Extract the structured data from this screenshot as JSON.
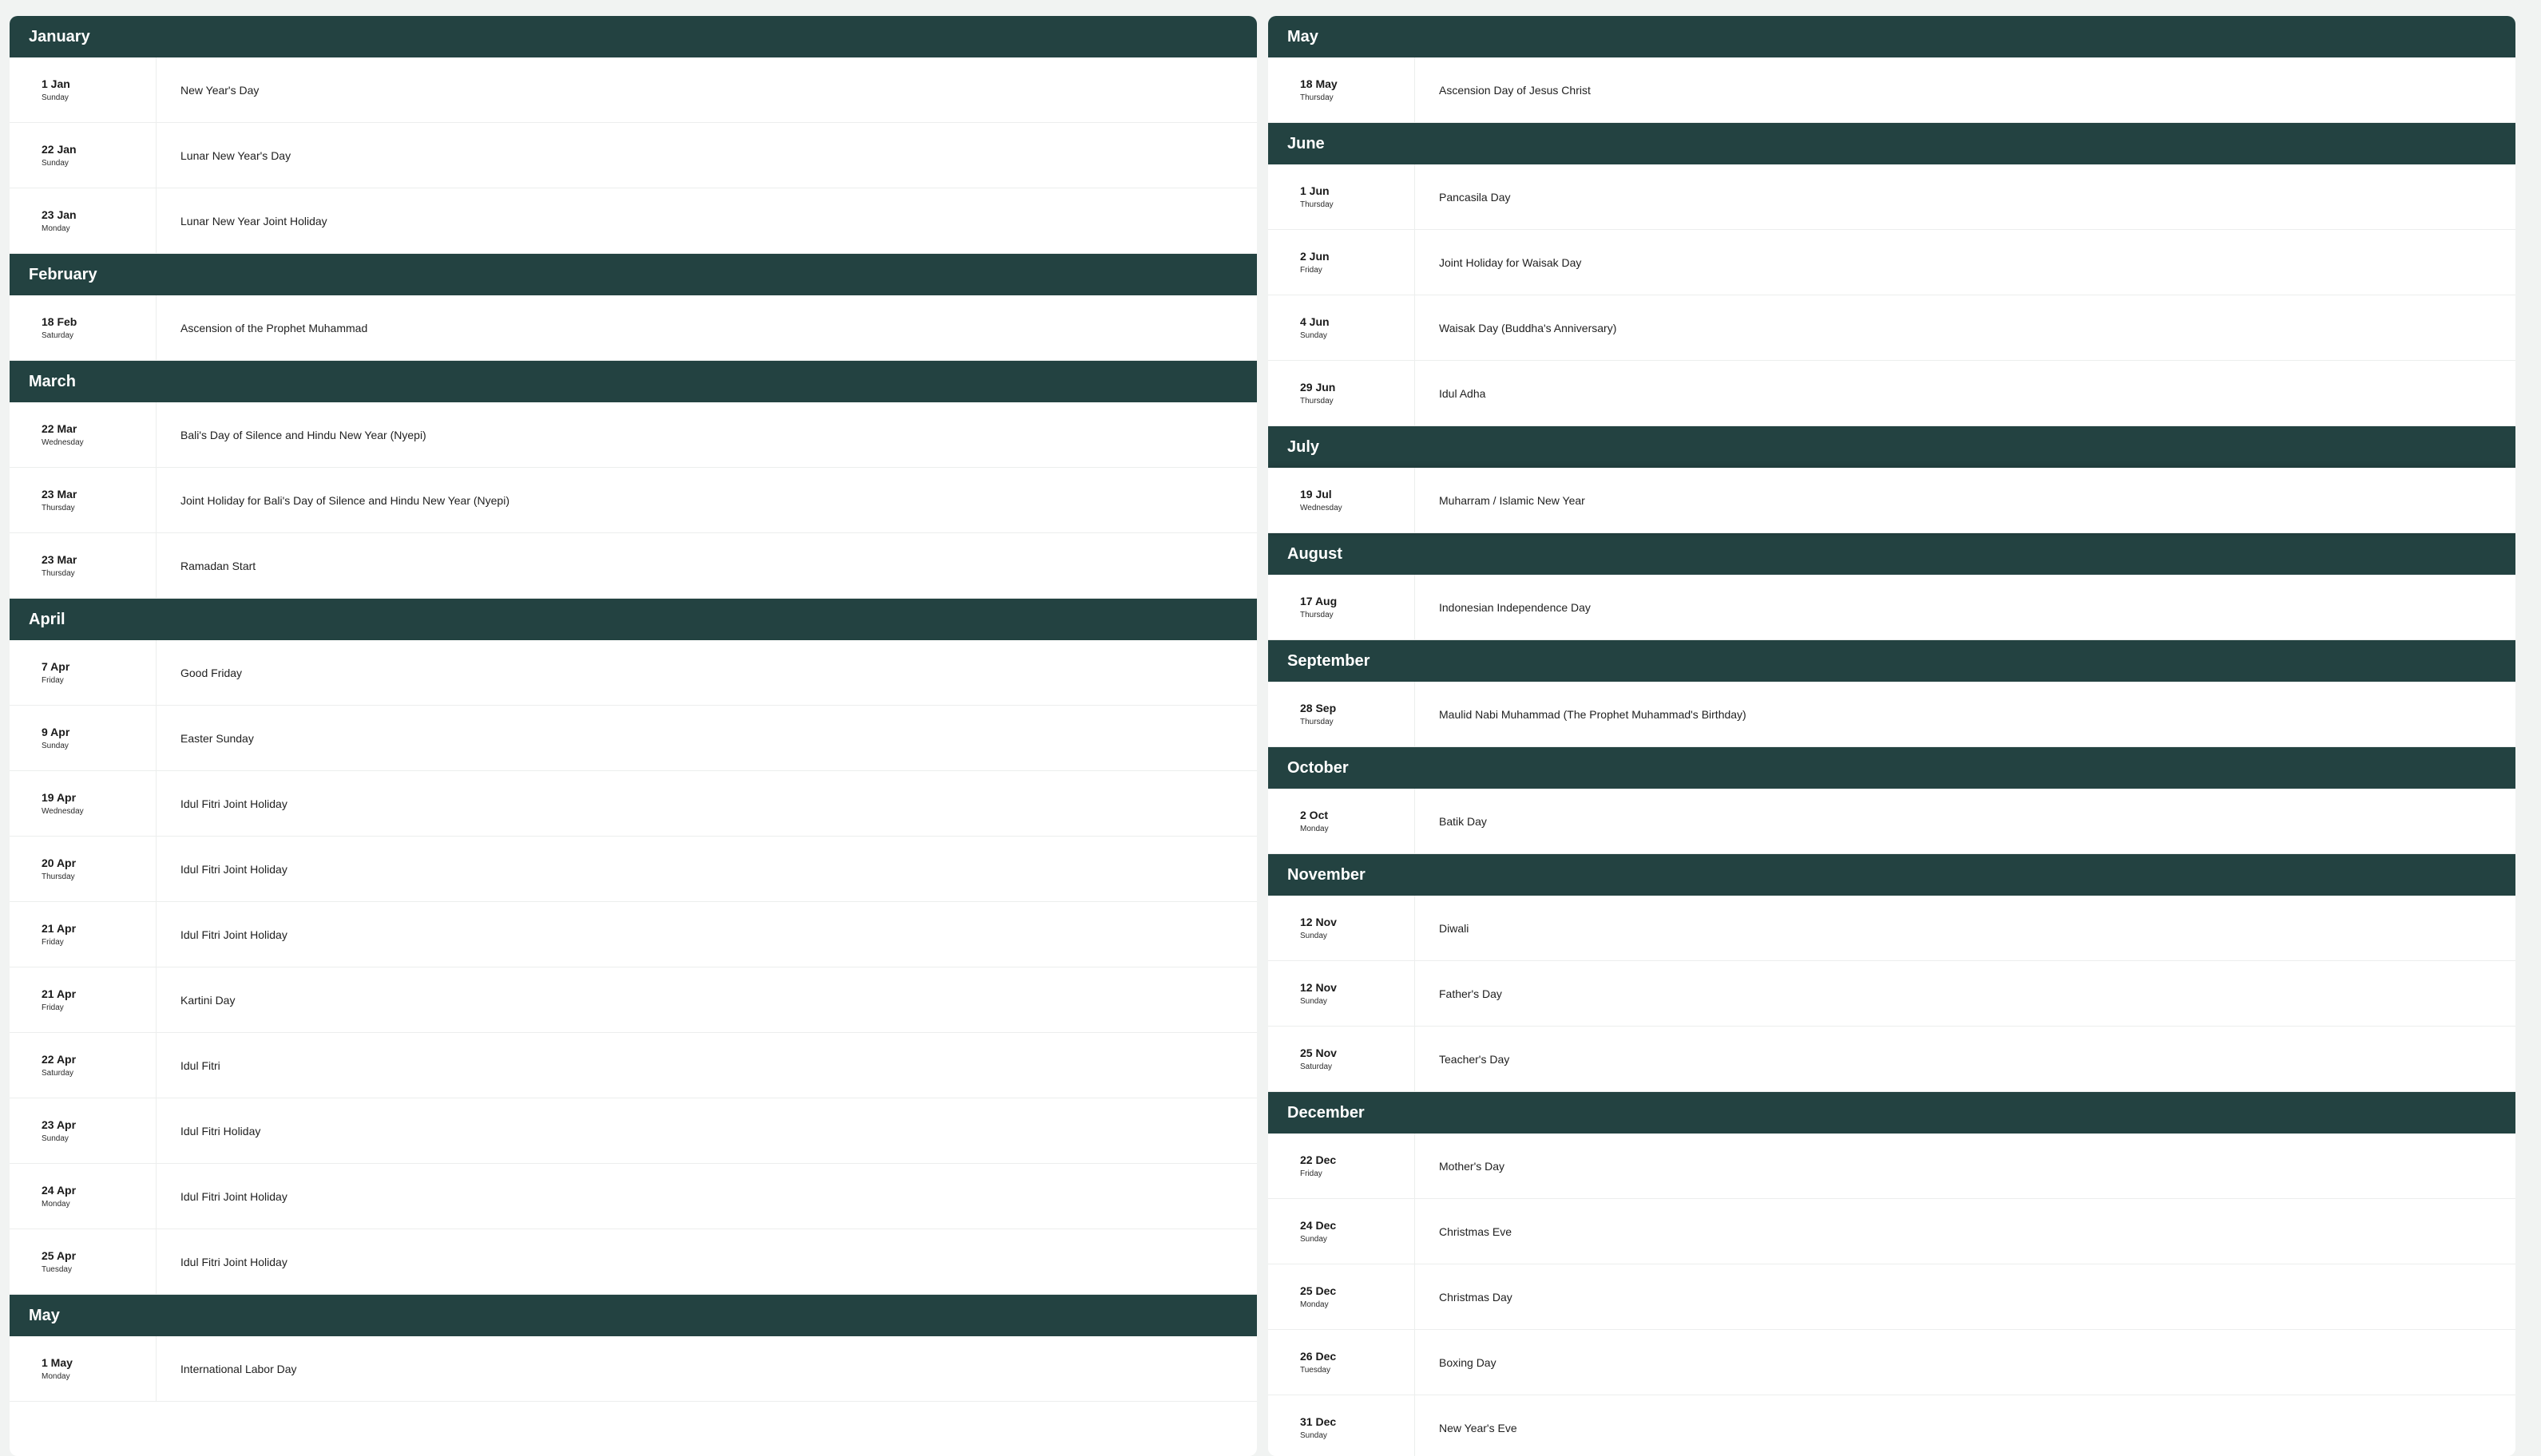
{
  "left_column": [
    {
      "month": "January",
      "holidays": [
        {
          "date": "1 Jan",
          "weekday": "Sunday",
          "name": "New Year's Day"
        },
        {
          "date": "22 Jan",
          "weekday": "Sunday",
          "name": "Lunar New Year's Day"
        },
        {
          "date": "23 Jan",
          "weekday": "Monday",
          "name": "Lunar New Year Joint Holiday"
        }
      ]
    },
    {
      "month": "February",
      "holidays": [
        {
          "date": "18 Feb",
          "weekday": "Saturday",
          "name": "Ascension of the Prophet Muhammad"
        }
      ]
    },
    {
      "month": "March",
      "holidays": [
        {
          "date": "22 Mar",
          "weekday": "Wednesday",
          "name": "Bali's Day of Silence and Hindu New Year (Nyepi)"
        },
        {
          "date": "23 Mar",
          "weekday": "Thursday",
          "name": "Joint Holiday for Bali's Day of Silence and Hindu New Year (Nyepi)"
        },
        {
          "date": "23 Mar",
          "weekday": "Thursday",
          "name": "Ramadan Start"
        }
      ]
    },
    {
      "month": "April",
      "holidays": [
        {
          "date": "7 Apr",
          "weekday": "Friday",
          "name": "Good Friday"
        },
        {
          "date": "9 Apr",
          "weekday": "Sunday",
          "name": "Easter Sunday"
        },
        {
          "date": "19 Apr",
          "weekday": "Wednesday",
          "name": "Idul Fitri Joint Holiday"
        },
        {
          "date": "20 Apr",
          "weekday": "Thursday",
          "name": "Idul Fitri Joint Holiday"
        },
        {
          "date": "21 Apr",
          "weekday": "Friday",
          "name": "Idul Fitri Joint Holiday"
        },
        {
          "date": "21 Apr",
          "weekday": "Friday",
          "name": "Kartini Day"
        },
        {
          "date": "22 Apr",
          "weekday": "Saturday",
          "name": "Idul Fitri"
        },
        {
          "date": "23 Apr",
          "weekday": "Sunday",
          "name": "Idul Fitri Holiday"
        },
        {
          "date": "24 Apr",
          "weekday": "Monday",
          "name": "Idul Fitri Joint Holiday"
        },
        {
          "date": "25 Apr",
          "weekday": "Tuesday",
          "name": "Idul Fitri Joint Holiday"
        }
      ]
    },
    {
      "month": "May",
      "holidays": [
        {
          "date": "1 May",
          "weekday": "Monday",
          "name": "International Labor Day"
        }
      ]
    }
  ],
  "right_column": [
    {
      "month": "May",
      "holidays": [
        {
          "date": "18 May",
          "weekday": "Thursday",
          "name": "Ascension Day of Jesus Christ"
        }
      ]
    },
    {
      "month": "June",
      "holidays": [
        {
          "date": "1 Jun",
          "weekday": "Thursday",
          "name": "Pancasila Day"
        },
        {
          "date": "2 Jun",
          "weekday": "Friday",
          "name": "Joint Holiday for Waisak Day"
        },
        {
          "date": "4 Jun",
          "weekday": "Sunday",
          "name": "Waisak Day (Buddha's Anniversary)"
        },
        {
          "date": "29 Jun",
          "weekday": "Thursday",
          "name": "Idul Adha"
        }
      ]
    },
    {
      "month": "July",
      "holidays": [
        {
          "date": "19 Jul",
          "weekday": "Wednesday",
          "name": "Muharram / Islamic New Year",
          "highlight": true
        }
      ]
    },
    {
      "month": "August",
      "holidays": [
        {
          "date": "17 Aug",
          "weekday": "Thursday",
          "name": "Indonesian Independence Day"
        }
      ]
    },
    {
      "month": "September",
      "holidays": [
        {
          "date": "28 Sep",
          "weekday": "Thursday",
          "name": "Maulid Nabi Muhammad (The Prophet Muhammad's Birthday)"
        }
      ]
    },
    {
      "month": "October",
      "holidays": [
        {
          "date": "2 Oct",
          "weekday": "Monday",
          "name": "Batik Day"
        }
      ]
    },
    {
      "month": "November",
      "holidays": [
        {
          "date": "12 Nov",
          "weekday": "Sunday",
          "name": "Diwali"
        },
        {
          "date": "12 Nov",
          "weekday": "Sunday",
          "name": "Father's Day"
        },
        {
          "date": "25 Nov",
          "weekday": "Saturday",
          "name": "Teacher's Day"
        }
      ]
    },
    {
      "month": "December",
      "holidays": [
        {
          "date": "22 Dec",
          "weekday": "Friday",
          "name": "Mother's Day"
        },
        {
          "date": "24 Dec",
          "weekday": "Sunday",
          "name": "Christmas Eve"
        },
        {
          "date": "25 Dec",
          "weekday": "Monday",
          "name": "Christmas Day"
        },
        {
          "date": "26 Dec",
          "weekday": "Tuesday",
          "name": "Boxing Day"
        },
        {
          "date": "31 Dec",
          "weekday": "Sunday",
          "name": "New Year's Eve"
        }
      ]
    }
  ],
  "colors": {
    "header_bg": "#234241",
    "header_text": "#ffffff",
    "row_bg": "#ffffff",
    "divider": "#eceeed"
  }
}
